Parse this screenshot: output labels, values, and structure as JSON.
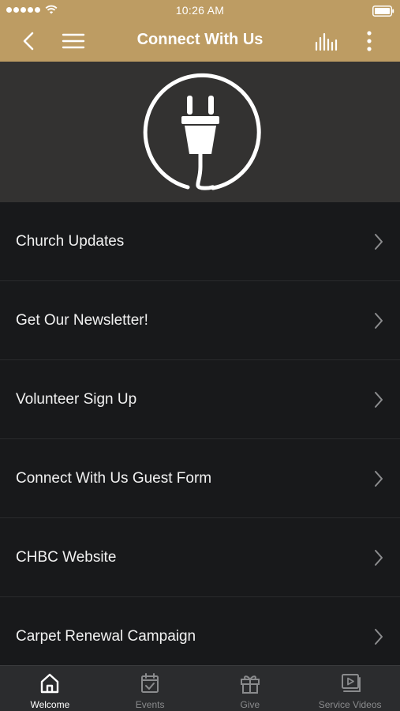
{
  "status_bar": {
    "time": "10:26 AM"
  },
  "header": {
    "title": "Connect With Us",
    "background_color": "#bd9c63",
    "icons": [
      "back-icon",
      "menu-icon",
      "audio-bars-icon",
      "more-vertical-icon"
    ]
  },
  "hero": {
    "icon": "plug-icon"
  },
  "menu": {
    "items": [
      {
        "label": "Church Updates"
      },
      {
        "label": "Get Our Newsletter!"
      },
      {
        "label": "Volunteer Sign Up"
      },
      {
        "label": "Connect With Us Guest Form"
      },
      {
        "label": "CHBC Website"
      },
      {
        "label": "Carpet Renewal Campaign"
      }
    ]
  },
  "tabbar": {
    "active_tab": "Welcome",
    "tabs": [
      {
        "label": "Welcome",
        "icon": "home-icon"
      },
      {
        "label": "Events",
        "icon": "calendar-check-icon"
      },
      {
        "label": "Give",
        "icon": "gift-icon"
      },
      {
        "label": "Service Videos",
        "icon": "video-playlist-icon"
      }
    ]
  }
}
